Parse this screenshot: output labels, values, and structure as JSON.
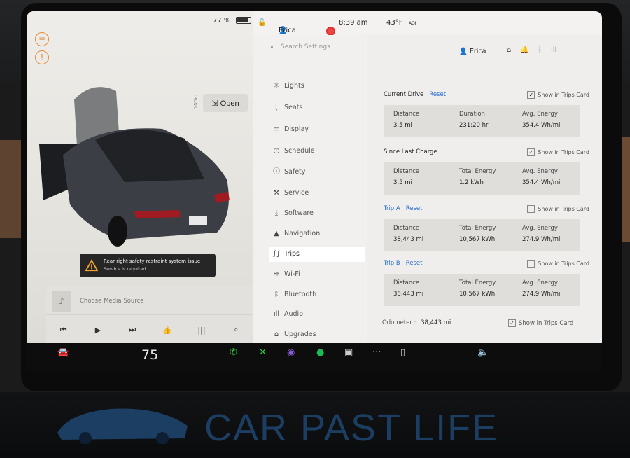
{
  "status_bar": {
    "battery": "77 %",
    "user": "Erica",
    "time": "8:39 am",
    "temperature": "43°F",
    "aqi": "AQI"
  },
  "car_panel": {
    "trunk_label": "TRUNK",
    "open_button": "Open",
    "alert_title": "Rear right safety restraint system issue",
    "alert_subtitle": "Service is required"
  },
  "media": {
    "source_placeholder": "Choose Media Source"
  },
  "settings_menu": {
    "search_placeholder": "Search Settings",
    "items": [
      {
        "label": "Lights",
        "icon": "light-icon"
      },
      {
        "label": "Seats",
        "icon": "seat-icon"
      },
      {
        "label": "Display",
        "icon": "display-icon"
      },
      {
        "label": "Schedule",
        "icon": "clock-icon"
      },
      {
        "label": "Safety",
        "icon": "safety-icon"
      },
      {
        "label": "Service",
        "icon": "wrench-icon"
      },
      {
        "label": "Software",
        "icon": "download-icon"
      },
      {
        "label": "Navigation",
        "icon": "navigation-icon"
      },
      {
        "label": "Trips",
        "icon": "trips-icon"
      },
      {
        "label": "Wi-Fi",
        "icon": "wifi-icon"
      },
      {
        "label": "Bluetooth",
        "icon": "bluetooth-icon"
      },
      {
        "label": "Audio",
        "icon": "audio-icon"
      },
      {
        "label": "Upgrades",
        "icon": "lock-icon"
      }
    ],
    "selected": "Trips"
  },
  "content_header": {
    "user": "Erica"
  },
  "trips": {
    "show_label": "Show in Trips Card",
    "reset_label": "Reset",
    "current_drive": {
      "title": "Current Drive",
      "checked": true,
      "distance_label": "Distance",
      "distance": "3.5 mi",
      "duration_label": "Duration",
      "duration": "231:20 hr",
      "energy_label": "Avg. Energy",
      "energy": "354.4 Wh/mi"
    },
    "since_last_charge": {
      "title": "Since Last Charge",
      "checked": true,
      "distance_label": "Distance",
      "distance": "3.5 mi",
      "total_label": "Total Energy",
      "total": "1.2 kWh",
      "energy_label": "Avg. Energy",
      "energy": "354.4 Wh/mi"
    },
    "trip_a": {
      "title": "Trip A",
      "checked": false,
      "distance_label": "Distance",
      "distance": "38,443 mi",
      "total_label": "Total Energy",
      "total": "10,567 kWh",
      "energy_label": "Avg. Energy",
      "energy": "274.9 Wh/mi"
    },
    "trip_b": {
      "title": "Trip B",
      "checked": false,
      "distance_label": "Distance",
      "distance": "38,443 mi",
      "total_label": "Total Energy",
      "total": "10,567 kWh",
      "energy_label": "Avg. Energy",
      "energy": "274.9 Wh/mi"
    },
    "odometer_label": "Odometer :",
    "odometer": "38,443 mi",
    "odometer_checked": true
  },
  "taskbar": {
    "temperature": "75"
  },
  "watermark": "CAR PAST LIFE",
  "colors": {
    "accent_blue": "#2a6fd1",
    "phone_green": "#2ecc40",
    "spotify_green": "#1db954",
    "watermark_blue": "#1c3e63"
  }
}
